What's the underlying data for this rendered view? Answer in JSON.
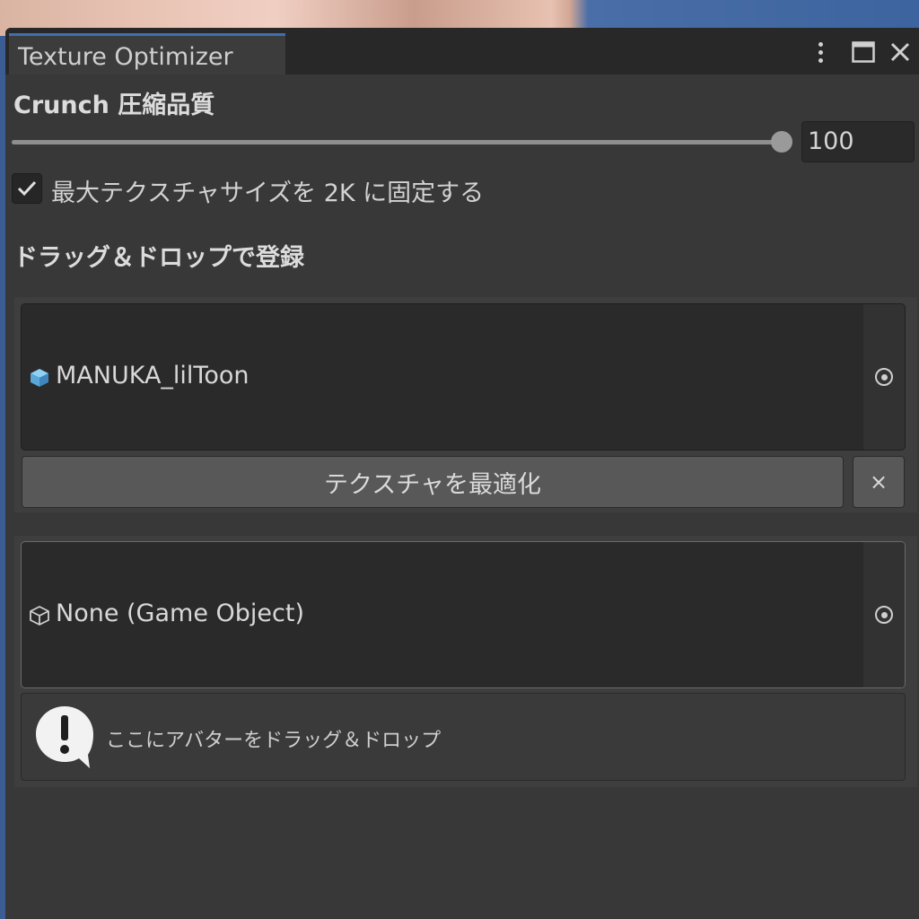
{
  "window": {
    "tab_title": "Texture Optimizer"
  },
  "crunch": {
    "heading": "Crunch 圧縮品質",
    "slider_value": 100,
    "slider_max": 100,
    "field_value": "100"
  },
  "max_texture": {
    "checked": true,
    "label": "最大テクスチャサイズを 2K に固定する"
  },
  "drag_section": {
    "heading": "ドラッグ＆ドロップで登録"
  },
  "avatar_entry": {
    "object_value": "MANUKA_lilToon",
    "optimize_button": "テクスチャを最適化",
    "remove_button": "×"
  },
  "empty_slot": {
    "object_value": "None (Game Object)",
    "help_text": "ここにアバターをドラッグ＆ドロップ"
  }
}
